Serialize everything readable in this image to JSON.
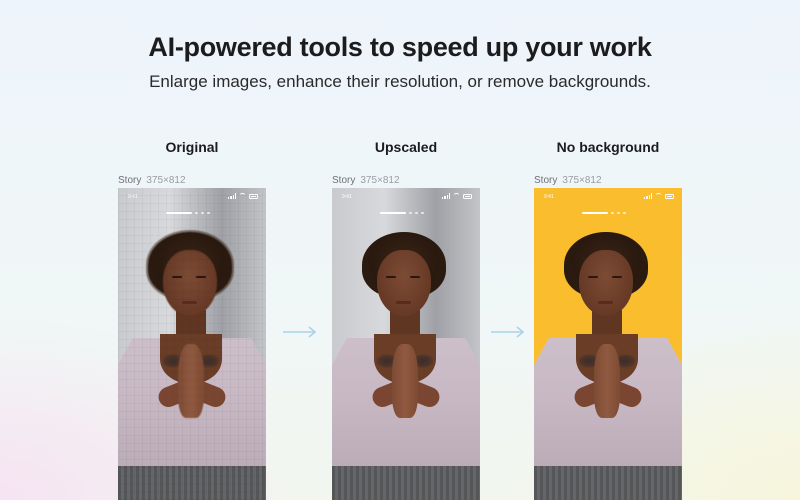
{
  "header": {
    "title": "AI-powered tools to speed up your work",
    "subtitle": "Enlarge images, enhance their resolution, or remove backgrounds."
  },
  "columns": [
    {
      "title": "Original",
      "story_label": "Story",
      "story_size": "375×812",
      "background": "#c9cacd",
      "status_time": "9:41"
    },
    {
      "title": "Upscaled",
      "story_label": "Story",
      "story_size": "375×812",
      "background": "#c9cacd",
      "status_time": "9:41"
    },
    {
      "title": "No background",
      "story_label": "Story",
      "story_size": "375×812",
      "background": "#f9bd2e",
      "status_time": "9:41"
    }
  ],
  "icons": {
    "arrow": "arrow-right-icon",
    "signal": "signal-icon",
    "wifi": "wifi-icon",
    "battery": "battery-icon"
  },
  "colors": {
    "arrow": "#a9d3ea",
    "no_background_fill": "#f9bd2e"
  }
}
